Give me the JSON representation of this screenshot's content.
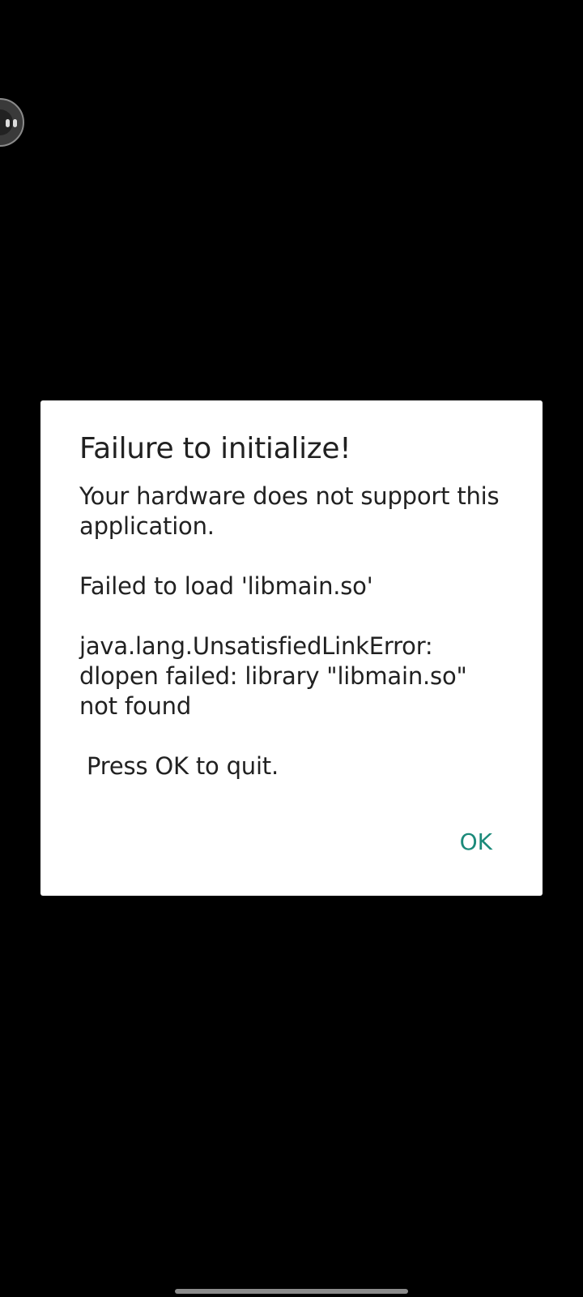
{
  "dialog": {
    "title": "Failure to initialize!",
    "message": "Your hardware does not support this application.\n\nFailed to load 'libmain.so'\n\njava.lang.UnsatisfiedLinkError: dlopen failed: library \"libmain.so\" not found\n\n Press OK to quit.",
    "ok_label": "OK"
  },
  "colors": {
    "background": "#000000",
    "dialog_background": "#ffffff",
    "text": "#212121",
    "accent": "#1b8a7a"
  },
  "icons": {
    "floating_bubble": "floating-chat-bubble-icon",
    "nav_handle": "gesture-nav-handle"
  }
}
